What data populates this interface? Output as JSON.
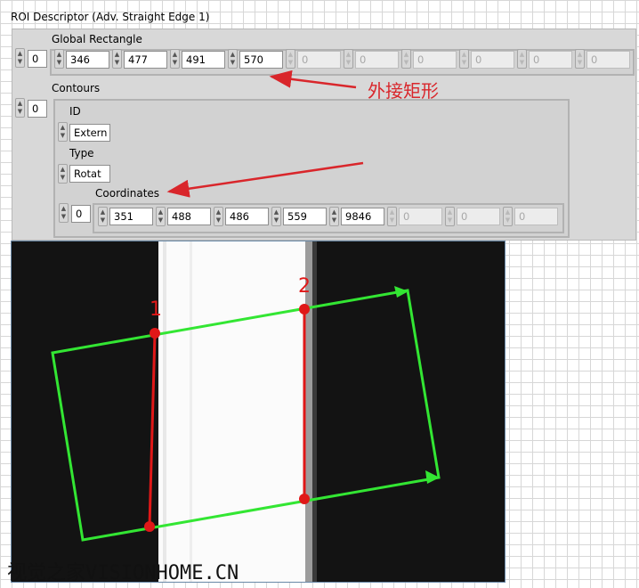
{
  "title": "ROI Descriptor (Adv. Straight Edge 1)",
  "global_rectangle": {
    "label": "Global Rectangle",
    "index": "0",
    "values": [
      "346",
      "477",
      "491",
      "570",
      "0",
      "0",
      "0",
      "0",
      "0",
      "0"
    ]
  },
  "contours": {
    "label": "Contours",
    "index": "0",
    "id_label": "ID",
    "id_value": "Extern",
    "type_label": "Type",
    "type_value": "Rotat",
    "coordinates_label": "Coordinates",
    "coordinates_index": "0",
    "coordinates": [
      "351",
      "488",
      "486",
      "559",
      "9846",
      "0",
      "0",
      "0"
    ]
  },
  "annotation": "外接矩形",
  "image": {
    "marker_1": "1",
    "marker_2": "2"
  },
  "watermark": "视觉之家VISIONHOME.CN",
  "colors": {
    "annotation": "#d9262b",
    "roi_green": "#33e633",
    "edge_red": "#e01818"
  }
}
